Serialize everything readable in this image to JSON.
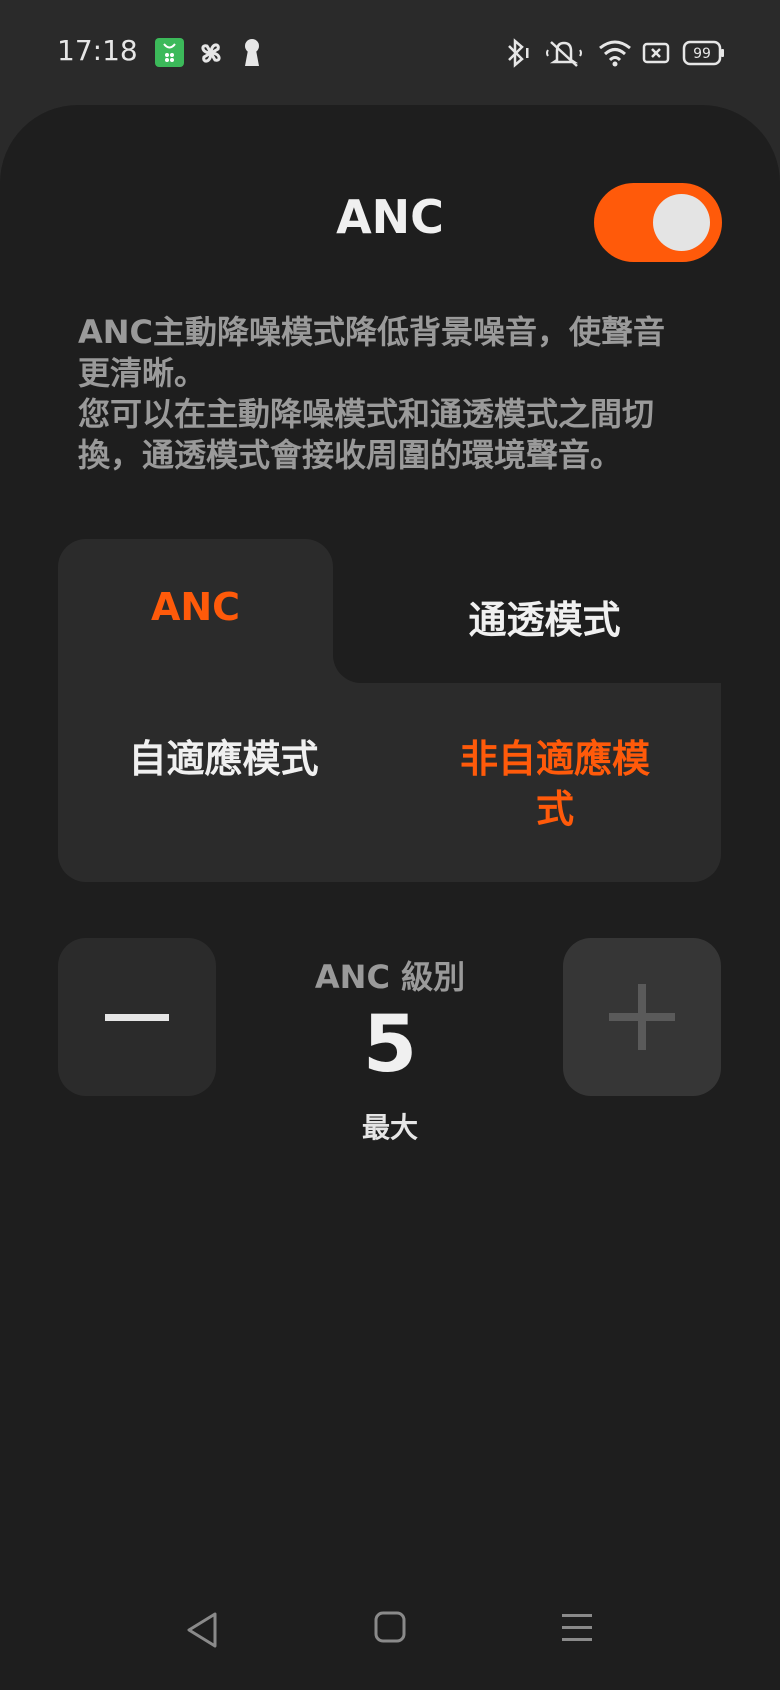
{
  "status_bar": {
    "time": "17:18",
    "battery": "99",
    "left_icons": [
      "shopping-bag-icon",
      "fan-icon",
      "keyhole-icon"
    ],
    "right_icons": [
      "bluetooth-icon",
      "mute-icon",
      "wifi-icon",
      "sim-icon",
      "battery-icon"
    ]
  },
  "header": {
    "title": "ANC",
    "toggle_on": true
  },
  "description": {
    "line1": "ANC主動降噪模式降低背景噪音，使聲音",
    "line2": "更清晰。",
    "line3": "您可以在主動降噪模式和通透模式之間切",
    "line4": "換，通透模式會接收周圍的環境聲音。"
  },
  "mode_tabs": {
    "anc": "ANC",
    "transparency": "通透模式",
    "selected": "ANC"
  },
  "anc_options": {
    "adaptive": "自適應模式",
    "non_adaptive_line1": "非自適應模",
    "non_adaptive_line2": "式",
    "selected": "非自適應模式"
  },
  "level": {
    "title": "ANC 級別",
    "value": "5",
    "label": "最大"
  },
  "colors": {
    "accent": "#ff5a0a",
    "background": "#1e1e1e",
    "card": "#2b2b2b"
  }
}
